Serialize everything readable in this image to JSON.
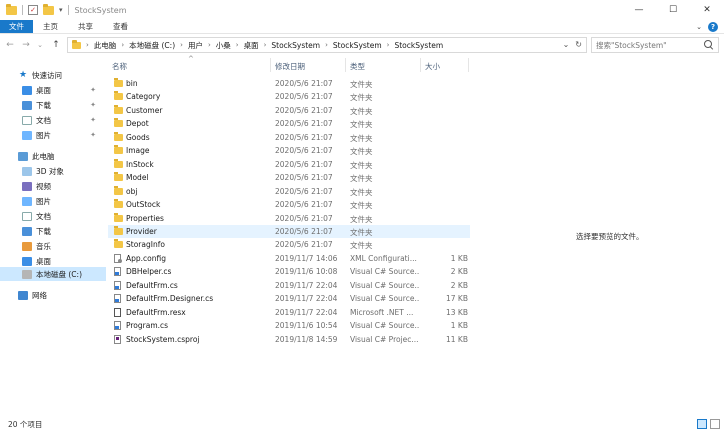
{
  "window": {
    "title": "StockSystem",
    "minimize": "—",
    "maximize": "☐",
    "close": "✕"
  },
  "ribbon": {
    "tabs": [
      "文件",
      "主页",
      "共享",
      "查看"
    ],
    "expand": "⌄",
    "help": "?"
  },
  "nav": {
    "back": "←",
    "forward": "→",
    "history": "⌄",
    "up": "↑",
    "breadcrumb": [
      "此电脑",
      "本地磁盘 (C:)",
      "用户",
      "小桑",
      "桌面",
      "StockSystem",
      "StockSystem",
      "StockSystem"
    ],
    "crumb_sep": "›",
    "dropdown": "⌄",
    "refresh": "↻",
    "search_placeholder": "搜索\"StockSystem\""
  },
  "sidebar": {
    "items": [
      {
        "label": "快速访问",
        "icon": "star-icon",
        "pinned": false
      },
      {
        "label": "桌面",
        "icon": "desktop-icon",
        "pinned": true
      },
      {
        "label": "下载",
        "icon": "download-icon",
        "pinned": true
      },
      {
        "label": "文档",
        "icon": "document-icon",
        "pinned": true
      },
      {
        "label": "图片",
        "icon": "picture-icon",
        "pinned": true
      },
      {
        "label": "此电脑",
        "icon": "computer-icon",
        "pinned": false
      },
      {
        "label": "3D 对象",
        "icon": "3d-objects-icon",
        "pinned": false
      },
      {
        "label": "视频",
        "icon": "video-icon",
        "pinned": false
      },
      {
        "label": "图片",
        "icon": "picture-icon",
        "pinned": false
      },
      {
        "label": "文档",
        "icon": "document-icon",
        "pinned": false
      },
      {
        "label": "下载",
        "icon": "download-icon",
        "pinned": false
      },
      {
        "label": "音乐",
        "icon": "music-icon",
        "pinned": false
      },
      {
        "label": "桌面",
        "icon": "desktop-icon",
        "pinned": false
      },
      {
        "label": "本地磁盘 (C:)",
        "icon": "disk-icon",
        "pinned": false,
        "selected": true
      },
      {
        "label": "网络",
        "icon": "network-icon",
        "pinned": false
      }
    ],
    "pin_glyph": "📌"
  },
  "list": {
    "columns": {
      "name": "名称",
      "date": "修改日期",
      "type": "类型",
      "size": "大小"
    },
    "sort_glyph": "^",
    "rows": [
      {
        "name": "bin",
        "date": "2020/5/6 21:07",
        "type": "文件夹",
        "size": "",
        "kind": "folder"
      },
      {
        "name": "Category",
        "date": "2020/5/6 21:07",
        "type": "文件夹",
        "size": "",
        "kind": "folder"
      },
      {
        "name": "Customer",
        "date": "2020/5/6 21:07",
        "type": "文件夹",
        "size": "",
        "kind": "folder"
      },
      {
        "name": "Depot",
        "date": "2020/5/6 21:07",
        "type": "文件夹",
        "size": "",
        "kind": "folder"
      },
      {
        "name": "Goods",
        "date": "2020/5/6 21:07",
        "type": "文件夹",
        "size": "",
        "kind": "folder"
      },
      {
        "name": "Image",
        "date": "2020/5/6 21:07",
        "type": "文件夹",
        "size": "",
        "kind": "folder"
      },
      {
        "name": "InStock",
        "date": "2020/5/6 21:07",
        "type": "文件夹",
        "size": "",
        "kind": "folder"
      },
      {
        "name": "Model",
        "date": "2020/5/6 21:07",
        "type": "文件夹",
        "size": "",
        "kind": "folder"
      },
      {
        "name": "obj",
        "date": "2020/5/6 21:07",
        "type": "文件夹",
        "size": "",
        "kind": "folder"
      },
      {
        "name": "OutStock",
        "date": "2020/5/6 21:07",
        "type": "文件夹",
        "size": "",
        "kind": "folder"
      },
      {
        "name": "Properties",
        "date": "2020/5/6 21:07",
        "type": "文件夹",
        "size": "",
        "kind": "folder"
      },
      {
        "name": "Provider",
        "date": "2020/5/6 21:07",
        "type": "文件夹",
        "size": "",
        "kind": "folder",
        "hover": true
      },
      {
        "name": "StoragInfo",
        "date": "2020/5/6 21:07",
        "type": "文件夹",
        "size": "",
        "kind": "folder"
      },
      {
        "name": "App.config",
        "date": "2019/11/7 14:06",
        "type": "XML Configurati...",
        "size": "1 KB",
        "kind": "cfg"
      },
      {
        "name": "DBHelper.cs",
        "date": "2019/11/6 10:08",
        "type": "Visual C# Source...",
        "size": "2 KB",
        "kind": "cs"
      },
      {
        "name": "DefaultFrm.cs",
        "date": "2019/11/7 22:04",
        "type": "Visual C# Source...",
        "size": "2 KB",
        "kind": "cs"
      },
      {
        "name": "DefaultFrm.Designer.cs",
        "date": "2019/11/7 22:04",
        "type": "Visual C# Source...",
        "size": "17 KB",
        "kind": "cs"
      },
      {
        "name": "DefaultFrm.resx",
        "date": "2019/11/7 22:04",
        "type": "Microsoft .NET ...",
        "size": "13 KB",
        "kind": "resx"
      },
      {
        "name": "Program.cs",
        "date": "2019/11/6 10:54",
        "type": "Visual C# Source...",
        "size": "1 KB",
        "kind": "cs"
      },
      {
        "name": "StockSystem.csproj",
        "date": "2019/11/8 14:59",
        "type": "Visual C# Projec...",
        "size": "11 KB",
        "kind": "proj"
      }
    ]
  },
  "preview": {
    "message": "选择要预览的文件。"
  },
  "status": {
    "count": "20 个项目"
  }
}
